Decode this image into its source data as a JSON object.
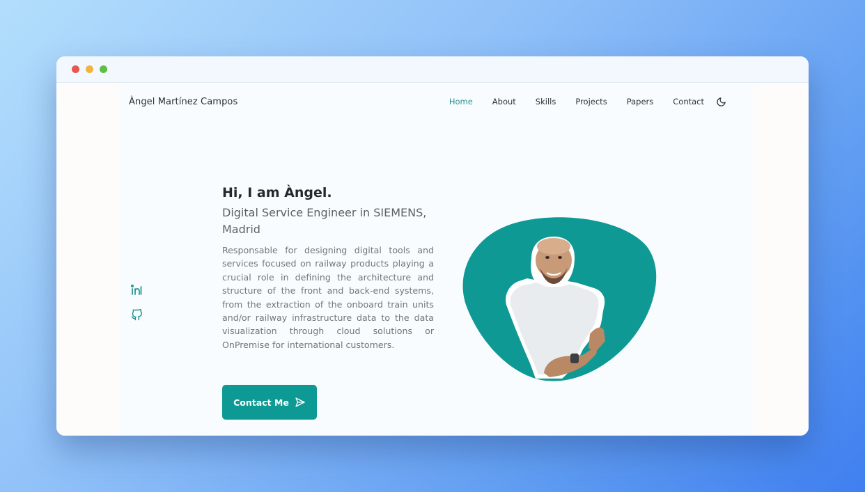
{
  "window": {
    "controls": {
      "close_color": "#e8574a",
      "minimize_color": "#f2b43a",
      "maximize_color": "#5bc043"
    }
  },
  "nav": {
    "logo": "Àngel Martínez Campos",
    "items": [
      {
        "label": "Home",
        "active": true
      },
      {
        "label": "About",
        "active": false
      },
      {
        "label": "Skills",
        "active": false
      },
      {
        "label": "Projects",
        "active": false
      },
      {
        "label": "Papers",
        "active": false
      },
      {
        "label": "Contact",
        "active": false
      }
    ],
    "theme_toggle_icon": "moon-icon"
  },
  "socials": [
    {
      "icon": "linkedin-icon"
    },
    {
      "icon": "github-icon"
    }
  ],
  "hero": {
    "title": "Hi, I am Àngel.",
    "subtitle": "Digital Service Engineer in SIEMENS, Madrid",
    "description": "Responsable for designing digital tools and services focused on railway products playing a crucial role in defining the architecture and structure of the front and back-end systems, from the extraction of the onboard train units and/or railway infrastructure data to the data visualization through cloud solutions or OnPremise for international customers.",
    "cta_label": "Contact Me",
    "cta_icon": "send-icon",
    "image": "profile-photo"
  },
  "colors": {
    "accent": "#0e9a94",
    "active_nav": "#27928f",
    "text_dark": "#24282b",
    "text_muted": "#70767b"
  }
}
